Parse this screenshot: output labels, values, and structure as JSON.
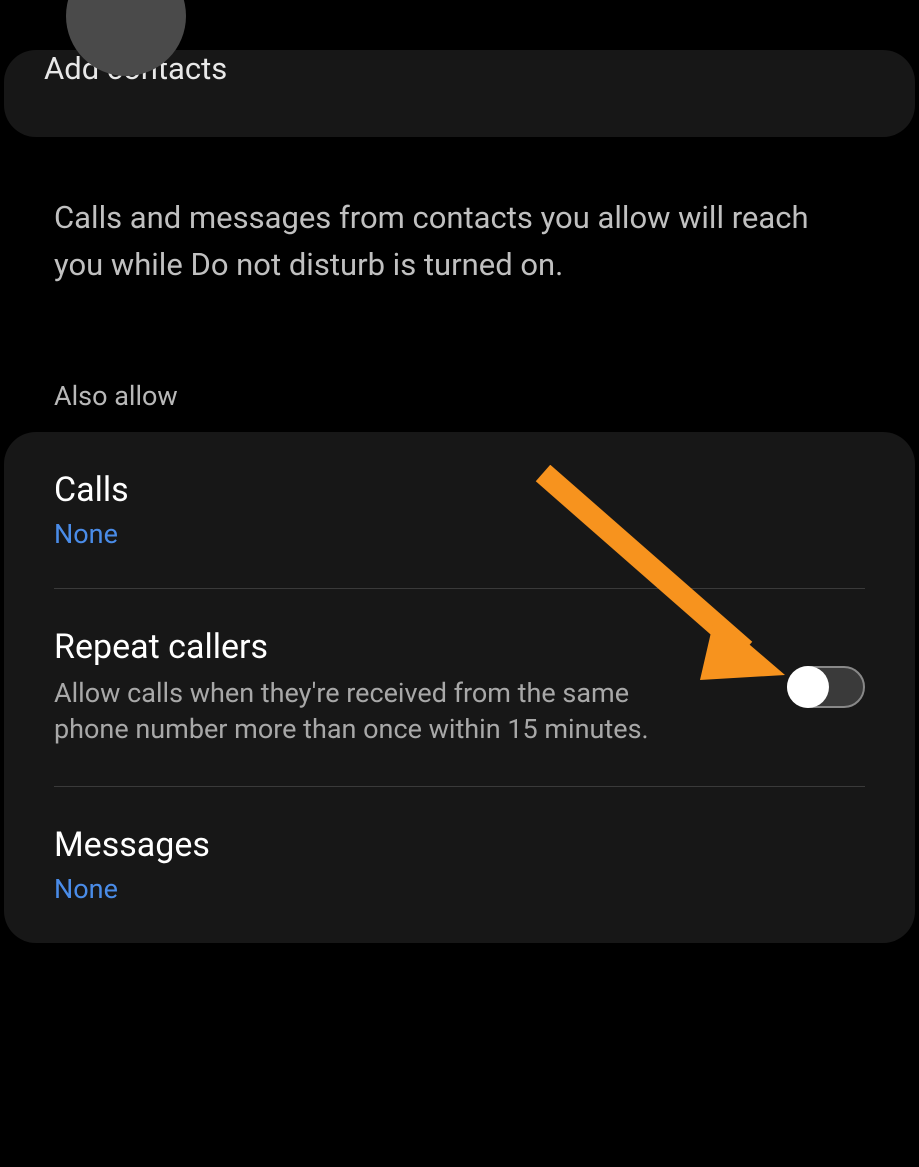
{
  "top_card": {
    "add_contacts_label": "Add contacts"
  },
  "description": "Calls and messages from contacts you allow will reach you while Do not disturb is turned on.",
  "section_header": "Also allow",
  "settings": {
    "calls": {
      "title": "Calls",
      "value": "None"
    },
    "repeat_callers": {
      "title": "Repeat callers",
      "description": "Allow calls when they're received from the same phone number more than once within 15 minutes."
    },
    "messages": {
      "title": "Messages",
      "value": "None"
    }
  }
}
